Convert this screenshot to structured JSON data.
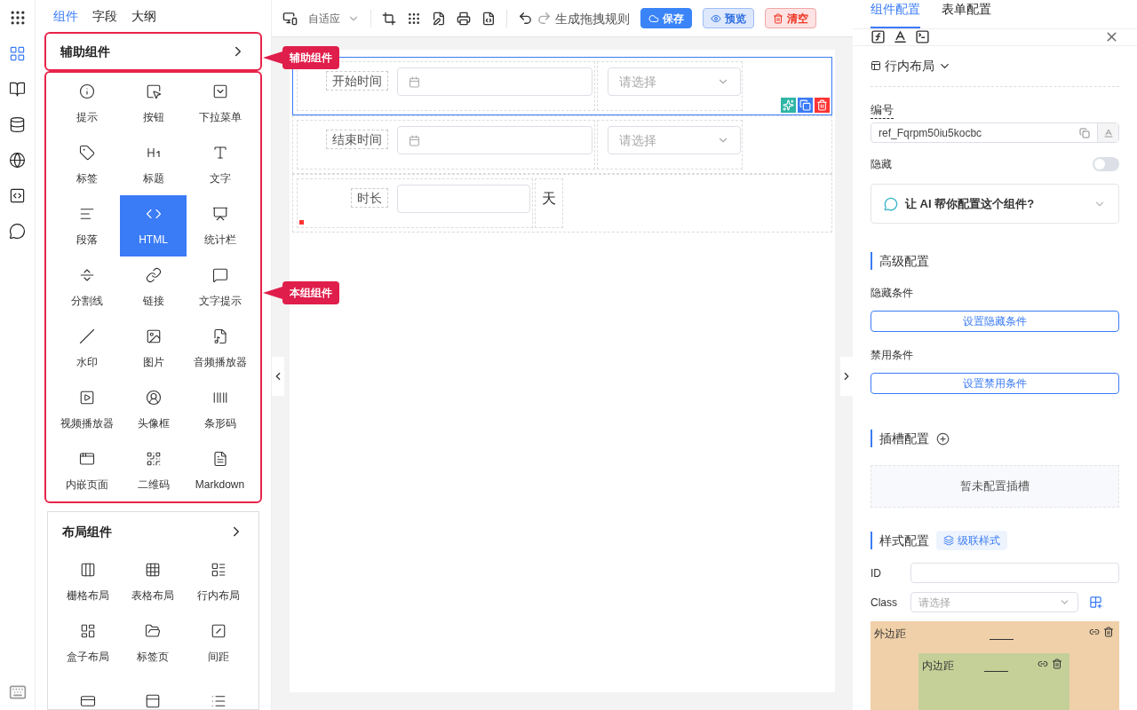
{
  "rail": [
    {
      "selected": true
    },
    {
      "selected": false
    },
    {
      "selected": false
    },
    {
      "selected": false
    },
    {
      "selected": false
    },
    {
      "selected": false
    }
  ],
  "panel_tabs": [
    {
      "label": "组件",
      "selected": true
    },
    {
      "label": "字段",
      "selected": false
    },
    {
      "label": "大纲",
      "selected": false
    }
  ],
  "groups": [
    {
      "title": "辅助组件",
      "outlined": true,
      "items": [
        {
          "label": "提示",
          "selected": false
        },
        {
          "label": "按钮",
          "selected": false
        },
        {
          "label": "下拉菜单",
          "selected": false
        },
        {
          "label": "标签",
          "selected": false
        },
        {
          "label": "标题",
          "selected": false
        },
        {
          "label": "文字",
          "selected": false
        },
        {
          "label": "段落",
          "selected": false
        },
        {
          "label": "HTML",
          "selected": true
        },
        {
          "label": "统计栏",
          "selected": false
        },
        {
          "label": "分割线",
          "selected": false
        },
        {
          "label": "链接",
          "selected": false
        },
        {
          "label": "文字提示",
          "selected": false
        },
        {
          "label": "水印",
          "selected": false
        },
        {
          "label": "图片",
          "selected": false
        },
        {
          "label": "音频播放器",
          "selected": false
        },
        {
          "label": "视频播放器",
          "selected": false
        },
        {
          "label": "头像框",
          "selected": false
        },
        {
          "label": "条形码",
          "selected": false
        },
        {
          "label": "内嵌页面",
          "selected": false
        },
        {
          "label": "二维码",
          "selected": false
        },
        {
          "label": "Markdown",
          "selected": false
        }
      ]
    },
    {
      "title": "布局组件",
      "outlined": false,
      "items": [
        {
          "label": "栅格布局",
          "selected": false
        },
        {
          "label": "表格布局",
          "selected": false
        },
        {
          "label": "行内布局",
          "selected": false
        },
        {
          "label": "盒子布局",
          "selected": false
        },
        {
          "label": "标签页",
          "selected": false
        },
        {
          "label": "间距",
          "selected": false
        }
      ]
    }
  ],
  "callouts": [
    "辅助组件",
    "本组组件"
  ],
  "toolbar": {
    "device": "自适应",
    "action": "生成拖拽规则",
    "buttons": [
      {
        "label": "保存",
        "kind": "primary"
      },
      {
        "label": "预览",
        "kind": "secondary"
      },
      {
        "label": "清空",
        "kind": "danger"
      }
    ]
  },
  "form_rows": [
    {
      "selected": true,
      "cells": [
        {
          "label": "开始时间",
          "kind": "date"
        },
        {
          "kind": "select",
          "placeholder": "请选择"
        }
      ]
    },
    {
      "selected": false,
      "cells": [
        {
          "label": "结束时间",
          "kind": "date"
        },
        {
          "kind": "select",
          "placeholder": "请选择"
        }
      ]
    },
    {
      "selected": false,
      "cells": [
        {
          "label": "时长",
          "kind": "input"
        },
        {
          "kind": "text",
          "text": "天"
        }
      ]
    }
  ],
  "config": {
    "tabs": [
      {
        "label": "组件配置",
        "selected": true
      },
      {
        "label": "表单配置",
        "selected": false
      }
    ],
    "component_type": "行内布局",
    "ref_label": "编号",
    "ref_value": "ref_Fqrpm50iu5kocbc",
    "hidden": {
      "label": "隐藏",
      "on": false
    },
    "ai_prompt": "让 AI 帮你配置这个组件?",
    "advanced": {
      "title": "高级配置",
      "hide_label": "隐藏条件",
      "hide_button": "设置隐藏条件",
      "disable_label": "禁用条件",
      "disable_button": "设置禁用条件"
    },
    "slots": {
      "title": "插槽配置",
      "empty": "暂未配置插槽"
    },
    "style": {
      "title": "样式配置",
      "cascade": "级联样式",
      "id_label": "ID",
      "class_label": "Class",
      "class_placeholder": "请选择",
      "margin_label": "外边距",
      "padding_label": "内边距"
    }
  }
}
